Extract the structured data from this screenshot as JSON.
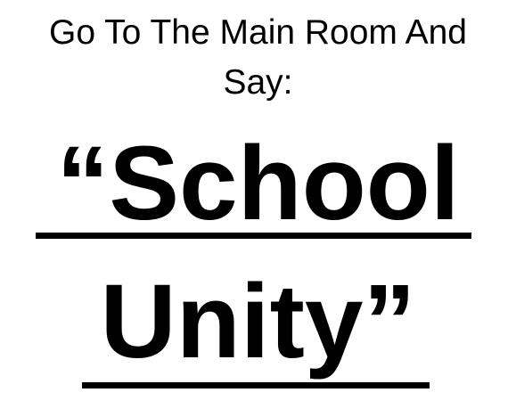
{
  "instruction": {
    "line1": "Go To The Main Room And",
    "line2": "Say:"
  },
  "phrase": {
    "line1": "“School",
    "line2": "Unity”"
  }
}
